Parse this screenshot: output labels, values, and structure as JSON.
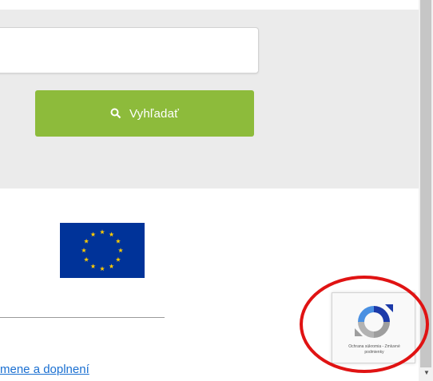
{
  "search": {
    "input_value": "",
    "input_placeholder": "",
    "button_label": "Vyhľadať"
  },
  "footer": {
    "link_text": "mene a doplnení"
  },
  "recaptcha": {
    "line1": "Ochrana súkromia - Zmluvné",
    "line2": "podmienky"
  },
  "icons": {
    "search": "search-icon",
    "recaptcha": "recaptcha-logo-icon",
    "flag": "eu-flag"
  },
  "colors": {
    "button": "#8dbb3b",
    "panel": "#ebebeb",
    "highlight": "#e01313",
    "flag": "#003399",
    "link": "#1a6fd1"
  }
}
